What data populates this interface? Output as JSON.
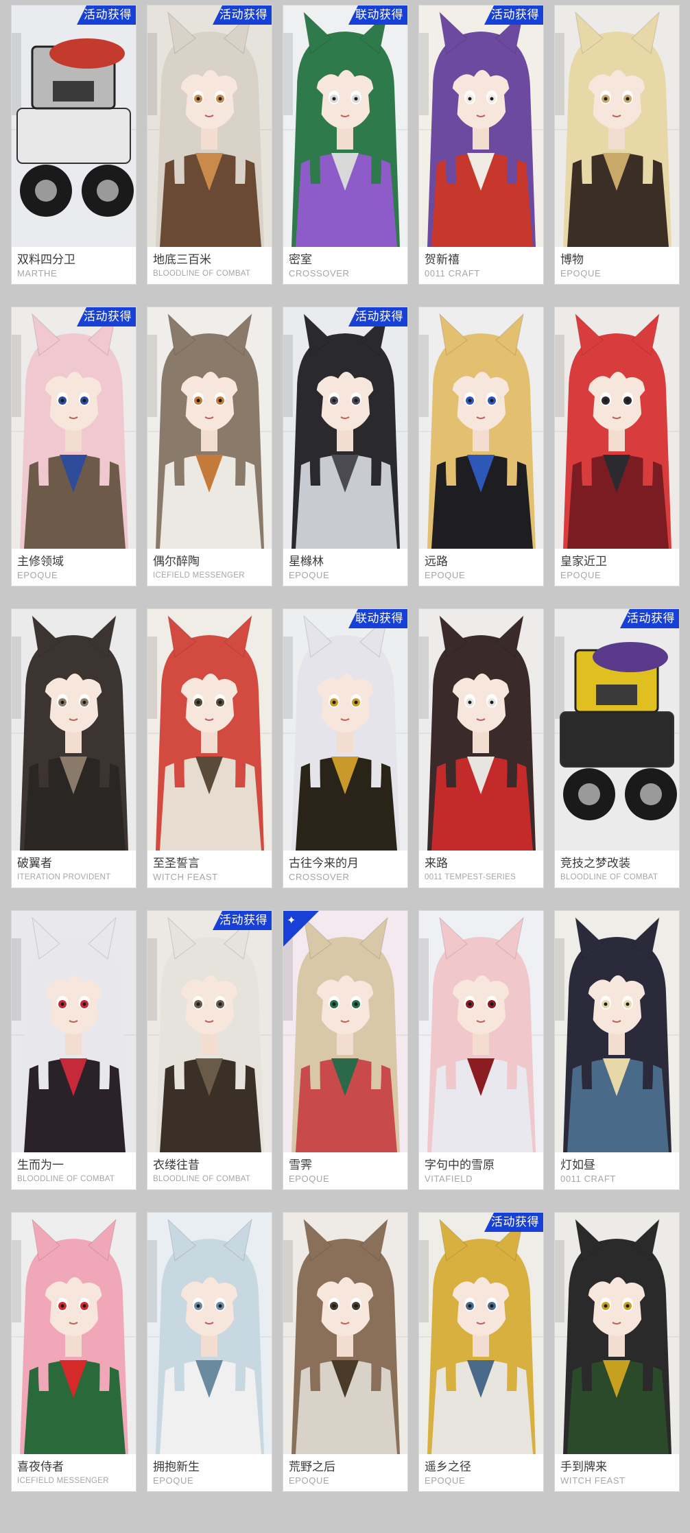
{
  "skins": [
    {
      "name": "双料四分卫",
      "series": "MARTHE",
      "badge": "活动获得",
      "hair": "#b9b9b9",
      "outfit": "#e8e8e8",
      "accent": "#c43a2c",
      "bg": "#e9ebee",
      "icon": "mech-icon"
    },
    {
      "name": "地底三百米",
      "series": "BLOODLINE OF COMBAT",
      "badge": "活动获得",
      "hair": "#d8d2c8",
      "outfit": "#6b4a33",
      "accent": "#c98a4a",
      "bg": "#e6e2dc",
      "icon": "character-portrait-icon"
    },
    {
      "name": "密室",
      "series": "CROSSOVER",
      "badge": "联动获得",
      "hair": "#2f7a4a",
      "outfit": "#8e5cc9",
      "accent": "#d8d8d8",
      "bg": "#eef0f2",
      "icon": "character-portrait-icon"
    },
    {
      "name": "贺新禧",
      "series": "0011 CRAFT",
      "badge": "活动获得",
      "hair": "#6c4aa0",
      "outfit": "#c8372c",
      "accent": "#f0ece4",
      "bg": "#f2efe9",
      "icon": "character-portrait-icon"
    },
    {
      "name": "博物",
      "series": "EPOQUE",
      "badge": "",
      "hair": "#e8d8a8",
      "outfit": "#3b2e24",
      "accent": "#c9a96a",
      "bg": "#ecebe8",
      "icon": "character-portrait-icon"
    },
    {
      "name": "主修领域",
      "series": "EPOQUE",
      "badge": "活动获得",
      "hair": "#f0c8d0",
      "outfit": "#6e5a48",
      "accent": "#2f4c9a",
      "bg": "#eeeceb",
      "icon": "character-portrait-icon"
    },
    {
      "name": "偶尔醉陶",
      "series": "ICEFIELD MESSENGER",
      "badge": "",
      "hair": "#8a7a6a",
      "outfit": "#ece8e2",
      "accent": "#c47a3a",
      "bg": "#f0eeeb",
      "icon": "character-portrait-icon"
    },
    {
      "name": "星橼林",
      "series": "EPOQUE",
      "badge": "活动获得",
      "hair": "#2a2a2e",
      "outfit": "#c8ccd2",
      "accent": "#4a4a50",
      "bg": "#e9ebee",
      "icon": "character-portrait-icon"
    },
    {
      "name": "远路",
      "series": "EPOQUE",
      "badge": "",
      "hair": "#e2c070",
      "outfit": "#1e1e22",
      "accent": "#2e58b8",
      "bg": "#eeeeee",
      "icon": "character-portrait-icon"
    },
    {
      "name": "皇家近卫",
      "series": "EPOQUE",
      "badge": "",
      "hair": "#d83c3c",
      "outfit": "#7a1c22",
      "accent": "#2a2a30",
      "bg": "#eeeae8",
      "icon": "character-portrait-icon"
    },
    {
      "name": "破翼者",
      "series": "ITERATION PROVIDENT",
      "badge": "",
      "hair": "#3c3430",
      "outfit": "#2a2624",
      "accent": "#8a7a6a",
      "bg": "#ebebeb",
      "icon": "character-portrait-icon"
    },
    {
      "name": "至圣誓言",
      "series": "WITCH FEAST",
      "badge": "",
      "hair": "#d24a40",
      "outfit": "#e6dcd0",
      "accent": "#5a4a3a",
      "bg": "#f0ece6",
      "icon": "character-portrait-icon"
    },
    {
      "name": "古往今来的月",
      "series": "CROSSOVER",
      "badge": "联动获得",
      "hair": "#e4e4ea",
      "outfit": "#2a2418",
      "accent": "#c99a2a",
      "bg": "#eceef0",
      "icon": "character-portrait-icon"
    },
    {
      "name": "来路",
      "series": "0011 TEMPEST-SERIES",
      "badge": "",
      "hair": "#3a2a2a",
      "outfit": "#c42a2a",
      "accent": "#e8e4e0",
      "bg": "#eeecea",
      "icon": "character-portrait-icon"
    },
    {
      "name": "竞技之梦改装",
      "series": "BLOODLINE OF COMBAT",
      "badge": "活动获得",
      "hair": "#e0c020",
      "outfit": "#2a2a2a",
      "accent": "#5a3a8a",
      "bg": "#ebebeb",
      "icon": "mech-icon"
    },
    {
      "name": "生而为一",
      "series": "BLOODLINE OF COMBAT",
      "badge": "",
      "hair": "#e8e8ec",
      "outfit": "#2a2228",
      "accent": "#c42a3a",
      "bg": "#e9e9ec",
      "icon": "character-portrait-icon"
    },
    {
      "name": "衣缕往昔",
      "series": "BLOODLINE OF COMBAT",
      "badge": "活动获得",
      "hair": "#e6e2dc",
      "outfit": "#3a3028",
      "accent": "#6a5a48",
      "bg": "#ece9e5",
      "icon": "character-portrait-icon"
    },
    {
      "name": "雪霁",
      "series": "EPOQUE",
      "badge": "",
      "hair": "#d8c8a8",
      "outfit": "#c84a4a",
      "accent": "#2a6a4a",
      "bg": "#f3e9ee",
      "icon": "character-portrait-icon",
      "corner": true
    },
    {
      "name": "字句中的雪原",
      "series": "VITAFIELD",
      "badge": "",
      "hair": "#f0c8cc",
      "outfit": "#e8e8ee",
      "accent": "#8a1c22",
      "bg": "#eef0f4",
      "icon": "character-portrait-icon"
    },
    {
      "name": "灯如昼",
      "series": "0011 CRAFT",
      "badge": "",
      "hair": "#2a2a3a",
      "outfit": "#4a6a8a",
      "accent": "#e8d8a8",
      "bg": "#efede8",
      "icon": "character-portrait-icon"
    },
    {
      "name": "喜夜侍者",
      "series": "ICEFIELD MESSENGER",
      "badge": "",
      "hair": "#f0a8b8",
      "outfit": "#2a6a3a",
      "accent": "#d42a2a",
      "bg": "#eeeeee",
      "icon": "character-portrait-icon"
    },
    {
      "name": "拥抱新生",
      "series": "EPOQUE",
      "badge": "",
      "hair": "#c8d8e0",
      "outfit": "#f0f0f0",
      "accent": "#6a8aa0",
      "bg": "#e8eef2",
      "icon": "character-portrait-icon"
    },
    {
      "name": "荒野之后",
      "series": "EPOQUE",
      "badge": "",
      "hair": "#8a7058",
      "outfit": "#d8d2c8",
      "accent": "#4a3a2a",
      "bg": "#eeebe6",
      "icon": "character-portrait-icon"
    },
    {
      "name": "遥乡之径",
      "series": "EPOQUE",
      "badge": "活动获得",
      "hair": "#d8b040",
      "outfit": "#e8e4de",
      "accent": "#4a6a8a",
      "bg": "#efede8",
      "icon": "character-portrait-icon"
    },
    {
      "name": "手到牌来",
      "series": "WITCH FEAST",
      "badge": "",
      "hair": "#2a2a2a",
      "outfit": "#2a4a2a",
      "accent": "#c8a020",
      "bg": "#ecebe8",
      "icon": "character-portrait-icon"
    }
  ]
}
